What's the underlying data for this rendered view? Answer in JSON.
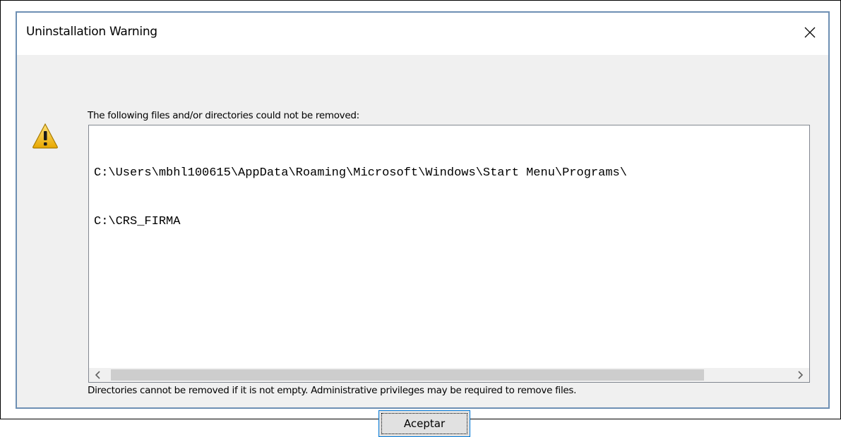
{
  "dialog": {
    "title": "Uninstallation Warning",
    "close_icon": "close-icon",
    "warning_icon": "warning-triangle-icon",
    "message_top": "The following files and/or directories could not be removed:",
    "files": [
      "C:\\Users\\mbhl100615\\AppData\\Roaming\\Microsoft\\Windows\\Start Menu\\Programs\\",
      "C:\\CRS_FIRMA"
    ],
    "message_bottom": "Directories cannot be removed if it is not empty. Administrative privileges may be required to remove files.",
    "ok_button_label": "Aceptar",
    "scroll_left_icon": "chevron-left-icon",
    "scroll_right_icon": "chevron-right-icon"
  },
  "colors": {
    "window_border": "#6d8fb3",
    "client_background": "#f0f0f0",
    "button_focus_border": "#0078d7",
    "warning_fill": "#f5c400"
  }
}
